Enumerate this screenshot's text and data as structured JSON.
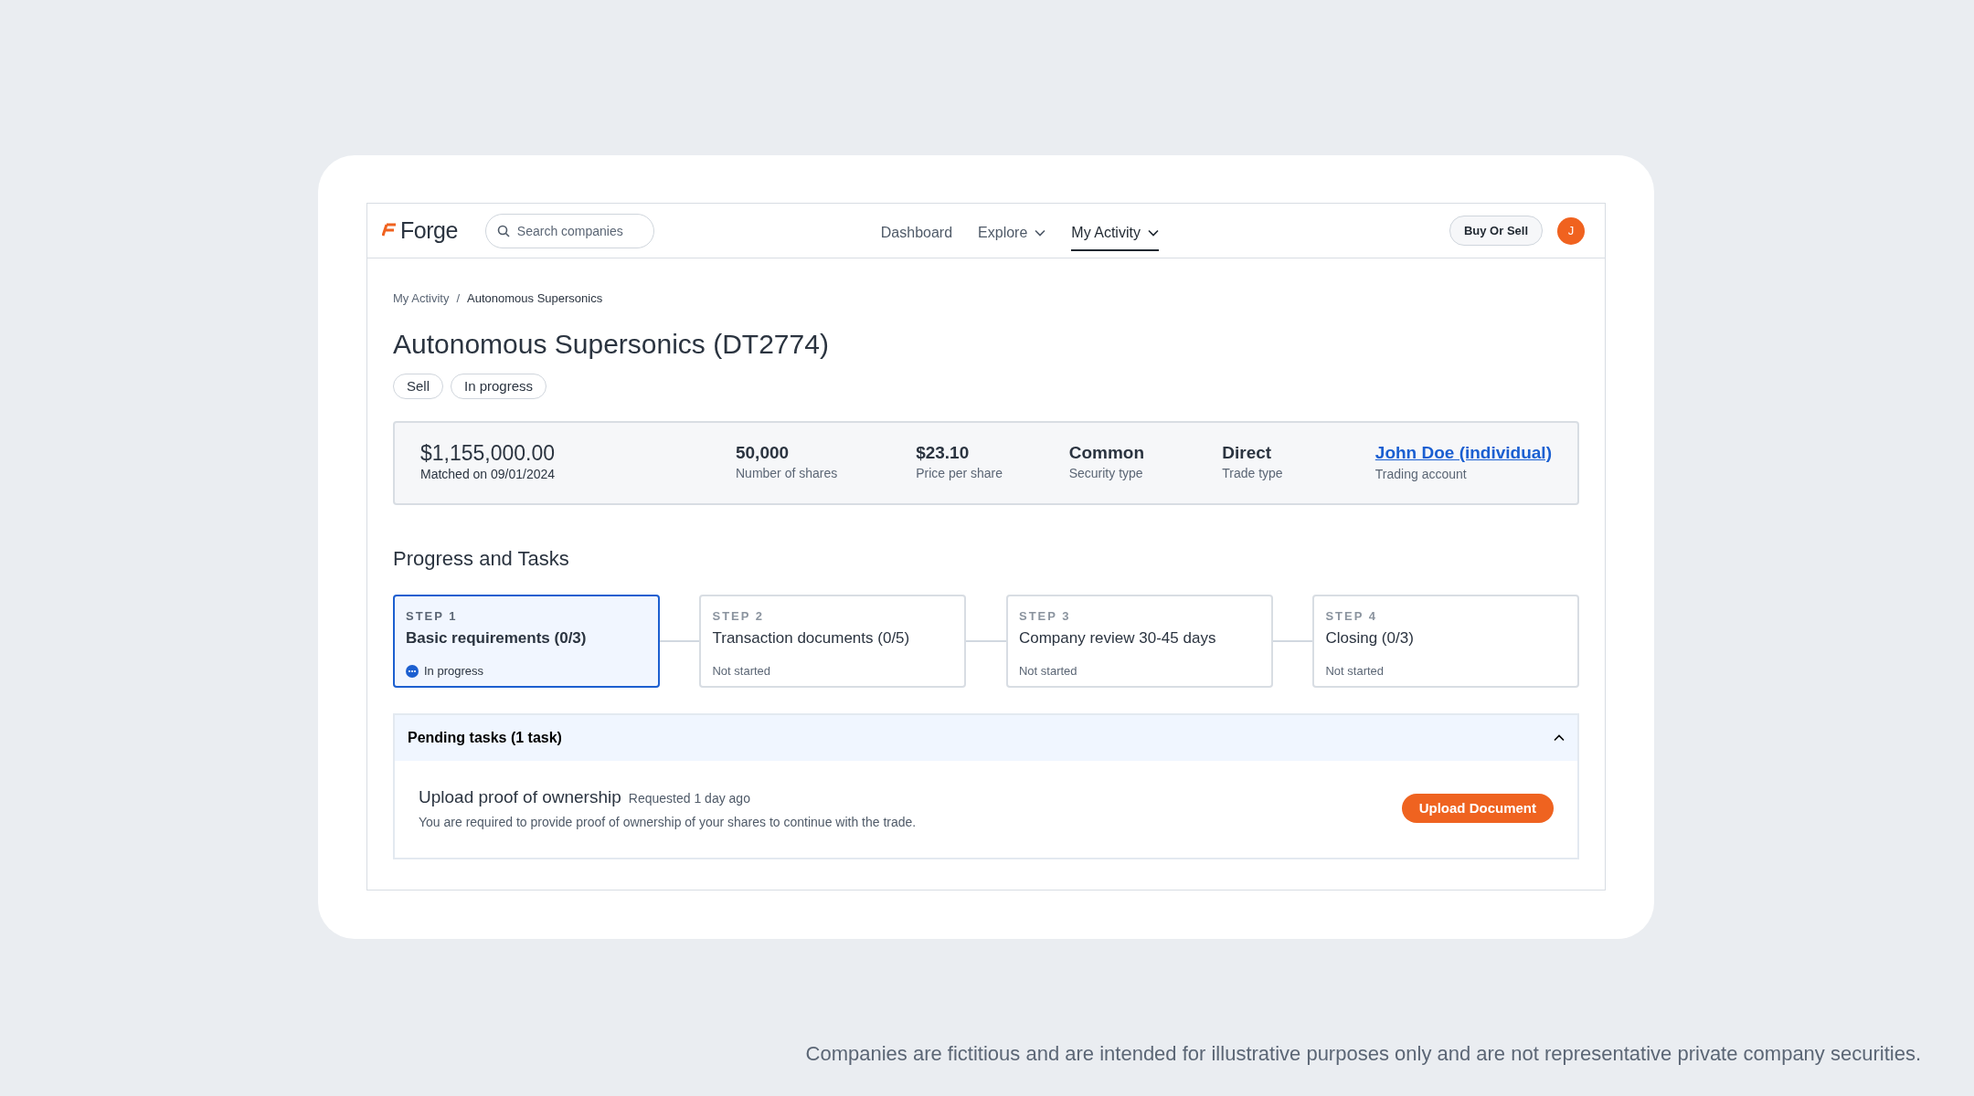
{
  "navbar": {
    "logo": "Forge",
    "search": {
      "placeholder": "Search companies"
    },
    "items": [
      {
        "label": "Dashboard",
        "selected": false,
        "has_menu": false
      },
      {
        "label": "Explore",
        "selected": false,
        "has_menu": true
      },
      {
        "label": "My Activity",
        "selected": true,
        "has_menu": true
      }
    ],
    "action_button": "Buy Or Sell",
    "avatar": "J"
  },
  "breadcrumb": {
    "separator": "/",
    "items": [
      {
        "label": "My Activity",
        "current": false
      },
      {
        "label": "Autonomous Supersonics",
        "current": true
      }
    ]
  },
  "title": "Autonomous Supersonics (DT2774)",
  "tags": [
    "Sell",
    "In progress"
  ],
  "summary": {
    "amount": "$1,155,000.00",
    "matched": "Matched on 09/01/2024",
    "facts": [
      {
        "value": "50,000",
        "label": "Number of shares",
        "kind": "text"
      },
      {
        "value": "$23.10",
        "label": "Price per share",
        "kind": "text"
      },
      {
        "value": "Common",
        "label": "Security type",
        "kind": "text"
      },
      {
        "value": "Direct",
        "label": "Trade type",
        "kind": "text"
      },
      {
        "value": "John Doe (individual)",
        "label": "Trading account",
        "kind": "link"
      }
    ]
  },
  "progress": {
    "heading": "Progress and Tasks",
    "steps": [
      {
        "step": "STEP 1",
        "title": "Basic requirements (0/3)",
        "status": "In progress",
        "selected": true,
        "kind": "in_progress"
      },
      {
        "step": "STEP 2",
        "title": "Transaction documents (0/5)",
        "status": "Not started",
        "selected": false,
        "kind": "not_started"
      },
      {
        "step": "STEP 3",
        "title": "Company review 30-45 days",
        "status": "Not started",
        "selected": false,
        "kind": "not_started"
      },
      {
        "step": "STEP 4",
        "title": "Closing (0/3)",
        "status": "Not started",
        "selected": false,
        "kind": "not_started"
      }
    ]
  },
  "pending": {
    "title": "Pending tasks (1 task)",
    "expanded": true,
    "tasks": [
      {
        "title": "Upload proof of ownership",
        "requested": "Requested 1 day ago",
        "description": "You are required to provide proof of ownership of your shares to continue with the trade.",
        "button": "Upload Document"
      }
    ]
  },
  "footnote": "Companies are fictitious and are intended for illustrative purposes only and are not representative private company securities."
}
